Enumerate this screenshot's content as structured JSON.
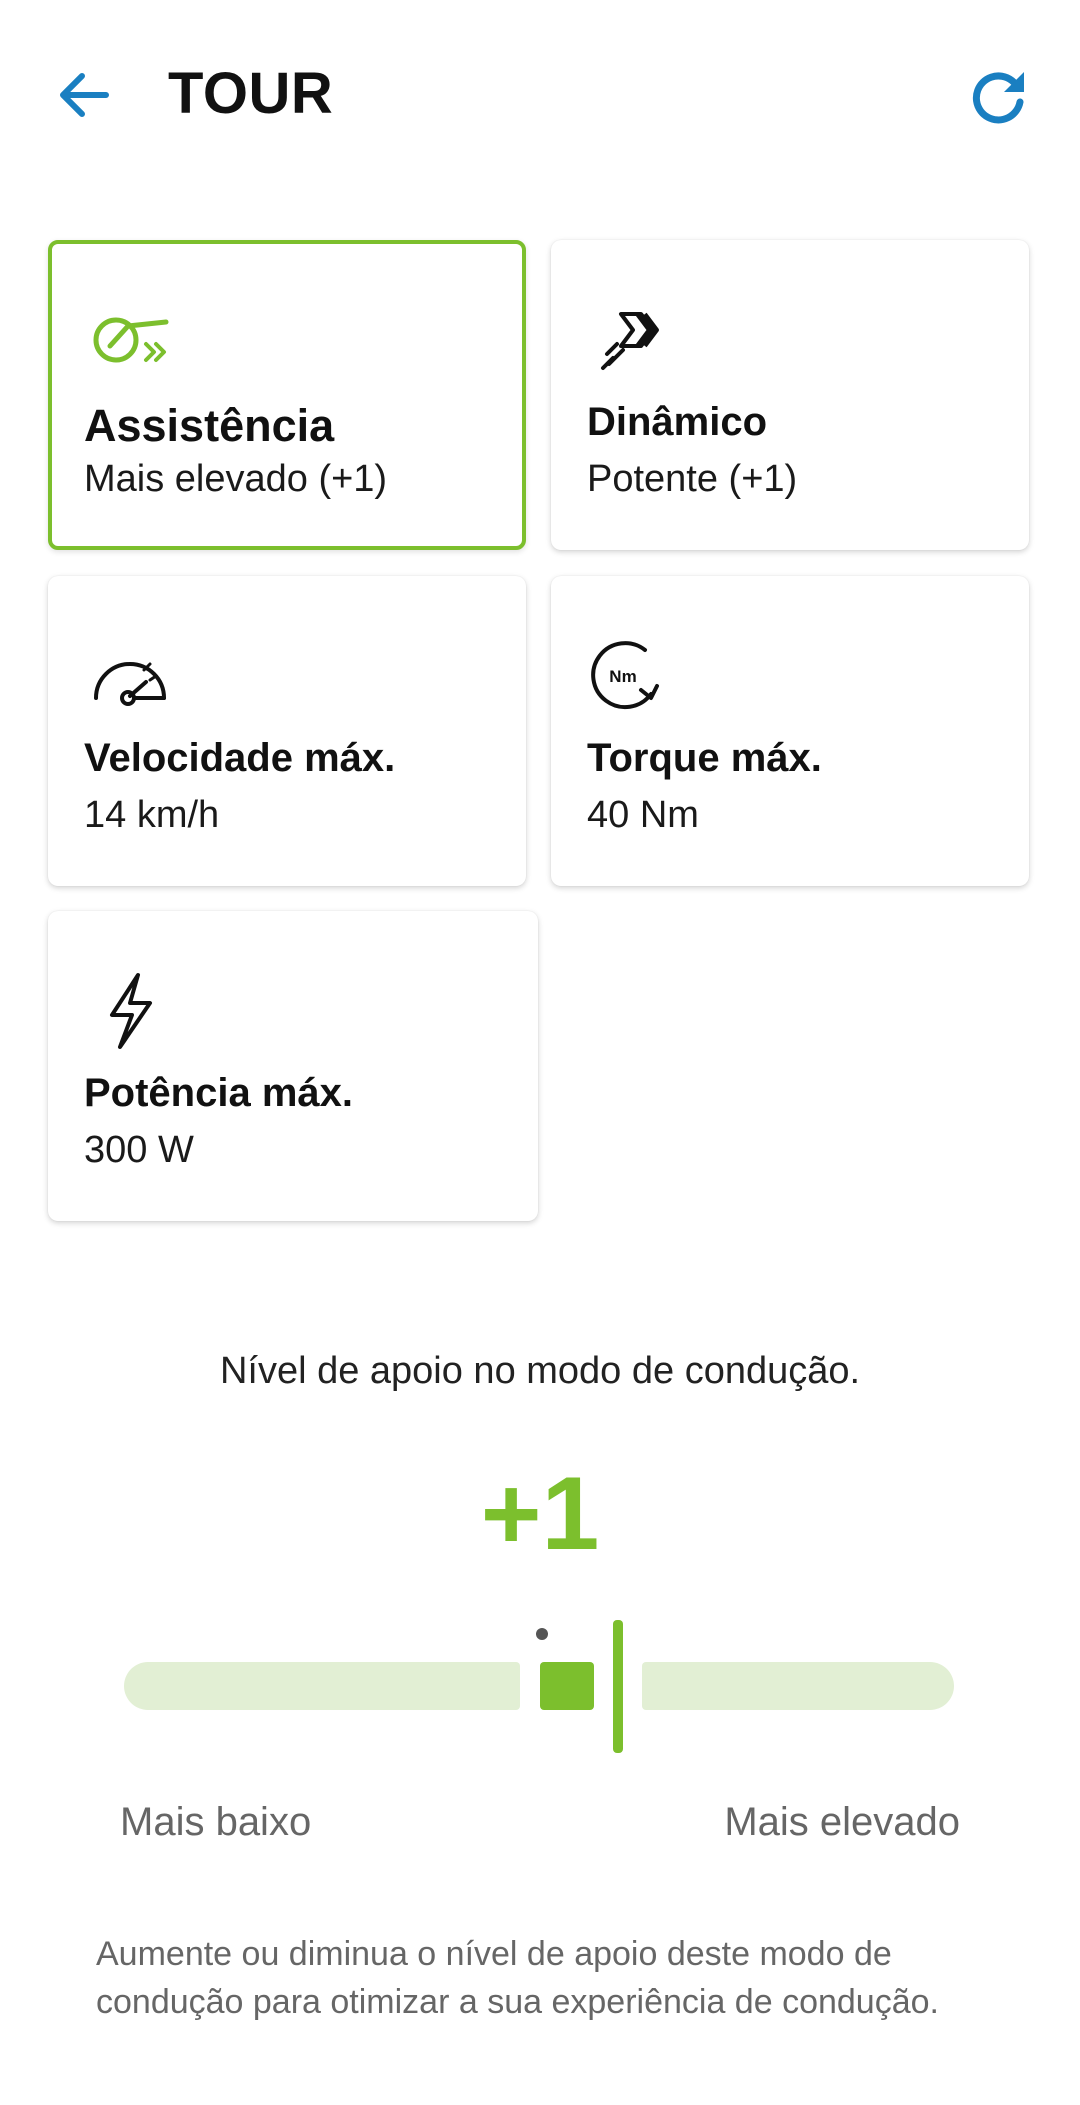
{
  "header": {
    "title": "TOUR"
  },
  "cards": [
    {
      "label": "Assistência",
      "value": "Mais elevado (+1)",
      "icon": "pedal-assist-icon",
      "selected": true
    },
    {
      "label": "Dinâmico",
      "value": "Potente (+1)",
      "icon": "dynamic-arrows-icon",
      "selected": false
    },
    {
      "label": "Velocidade máx.",
      "value": "14 km/h",
      "icon": "speedometer-icon",
      "selected": false
    },
    {
      "label": "Torque máx.",
      "value": "40 Nm",
      "icon": "torque-nm-icon",
      "icon_text": "Nm",
      "selected": false
    },
    {
      "label": "Potência máx.",
      "value": "300 W",
      "icon": "lightning-icon",
      "selected": false
    }
  ],
  "support": {
    "description": "Nível de apoio no modo de condução.",
    "level": "+1",
    "scale_low": "Mais baixo",
    "scale_high": "Mais elevado",
    "help": "Aumente ou diminua o nível de apoio deste modo de condução para otimizar a sua experiência de condução."
  },
  "colors": {
    "accent": "#7cbf2d",
    "link": "#1a7fc1",
    "track": "#e2efd4"
  }
}
